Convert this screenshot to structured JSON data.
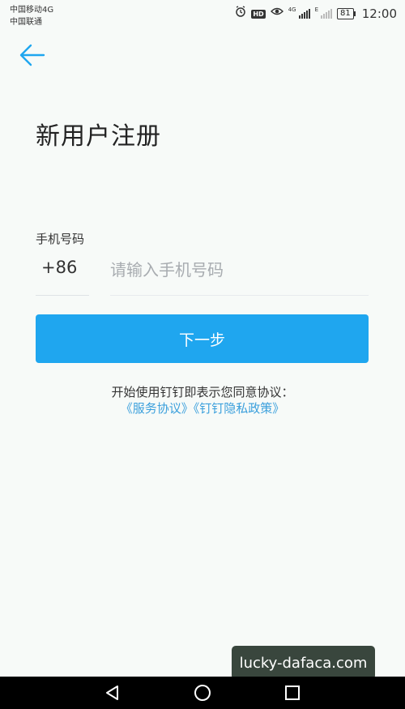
{
  "status_bar": {
    "carrier_primary": "中国移动4G",
    "carrier_secondary": "中国联通",
    "icons": [
      "alarm-icon",
      "hd-icon",
      "eye-icon",
      "signal-4g-icon",
      "signal-e-icon",
      "battery-icon"
    ],
    "hd_label": "HD",
    "net_4g_label": "4G",
    "net_e_label": "E",
    "battery_level": "81",
    "time": "12:00"
  },
  "header": {
    "back_icon": "arrow-left-icon"
  },
  "page": {
    "title": "新用户注册"
  },
  "form": {
    "phone_label": "手机号码",
    "country_code": "+86",
    "phone_placeholder": "请输入手机号码",
    "phone_value": ""
  },
  "actions": {
    "next_label": "下一步"
  },
  "agreement": {
    "text": "开始使用钉钉即表示您同意协议：",
    "service_link": "《服务协议》",
    "privacy_link": "《钉钉隐私政策》"
  },
  "watermark": {
    "text": "lucky-dafaca.com"
  },
  "nav_bar": {
    "icons": [
      "back-triangle-icon",
      "home-circle-icon",
      "recents-square-icon"
    ]
  },
  "colors": {
    "accent": "#1fa6ef",
    "link": "#3a9fdc",
    "background": "#f7faf8"
  }
}
